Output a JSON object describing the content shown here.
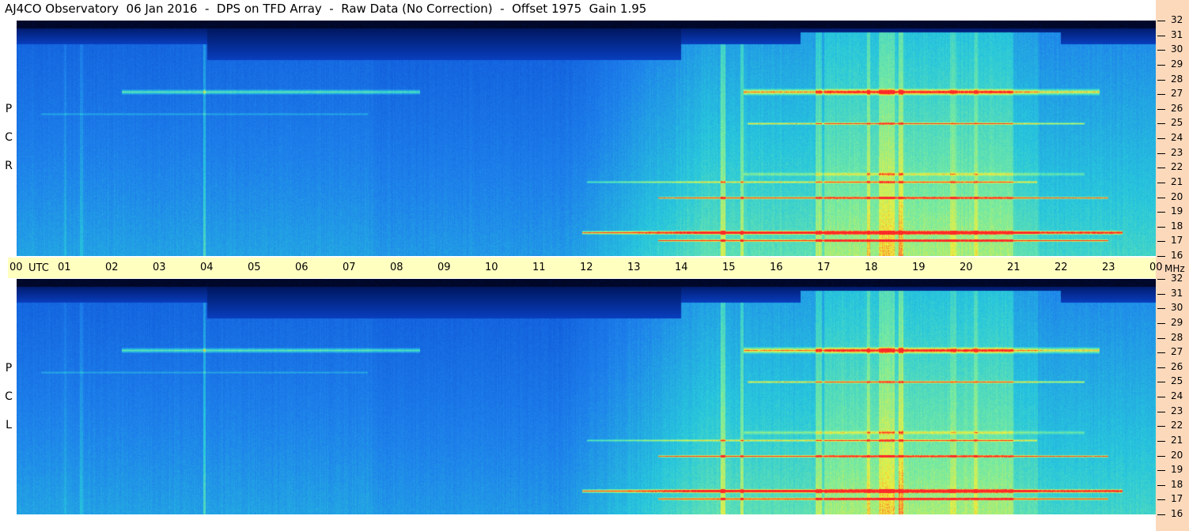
{
  "title": "AJ4CO Observatory  06 Jan 2016  -  DPS on TFD Array  -  Raw Data (No Correction)  -  Offset 1975  Gain 1.95",
  "panels": [
    {
      "label_chars": [
        "R",
        "C",
        "P"
      ]
    },
    {
      "label_chars": [
        "L",
        "C",
        "P"
      ]
    }
  ],
  "axis": {
    "utc_label": "UTC",
    "mhz_label": "MHz",
    "time_ticks": [
      "00",
      "01",
      "02",
      "03",
      "04",
      "05",
      "06",
      "07",
      "08",
      "09",
      "10",
      "11",
      "12",
      "13",
      "14",
      "15",
      "16",
      "17",
      "18",
      "19",
      "20",
      "21",
      "22",
      "23",
      "00"
    ],
    "freq_ticks": [
      "32",
      "31",
      "30",
      "29",
      "28",
      "27",
      "26",
      "25",
      "24",
      "23",
      "22",
      "21",
      "20",
      "19",
      "18",
      "17",
      "16"
    ]
  },
  "colors": {
    "background": "#ffffff",
    "time_bar": "#ffffc0",
    "right_strip": "#fdd9bb",
    "low": "#000010",
    "mid": "#1060e0",
    "high": "#40e0e0",
    "peak": "#ffff40",
    "hot": "#ff2020"
  },
  "chart_data": {
    "type": "heatmap",
    "title": "AJ4CO Observatory  06 Jan 2016  -  DPS on TFD Array  -  Raw Data (No Correction)  -  Offset 1975  Gain 1.95",
    "x": {
      "label": "UTC",
      "range": [
        0,
        24
      ],
      "ticks": [
        "00",
        "01",
        "02",
        "03",
        "04",
        "05",
        "06",
        "07",
        "08",
        "09",
        "10",
        "11",
        "12",
        "13",
        "14",
        "15",
        "16",
        "17",
        "18",
        "19",
        "20",
        "21",
        "22",
        "23",
        "00"
      ]
    },
    "y": {
      "label": "MHz",
      "range": [
        16,
        32
      ]
    },
    "series": [
      {
        "name": "RCP"
      },
      {
        "name": "LCP"
      }
    ]
  }
}
